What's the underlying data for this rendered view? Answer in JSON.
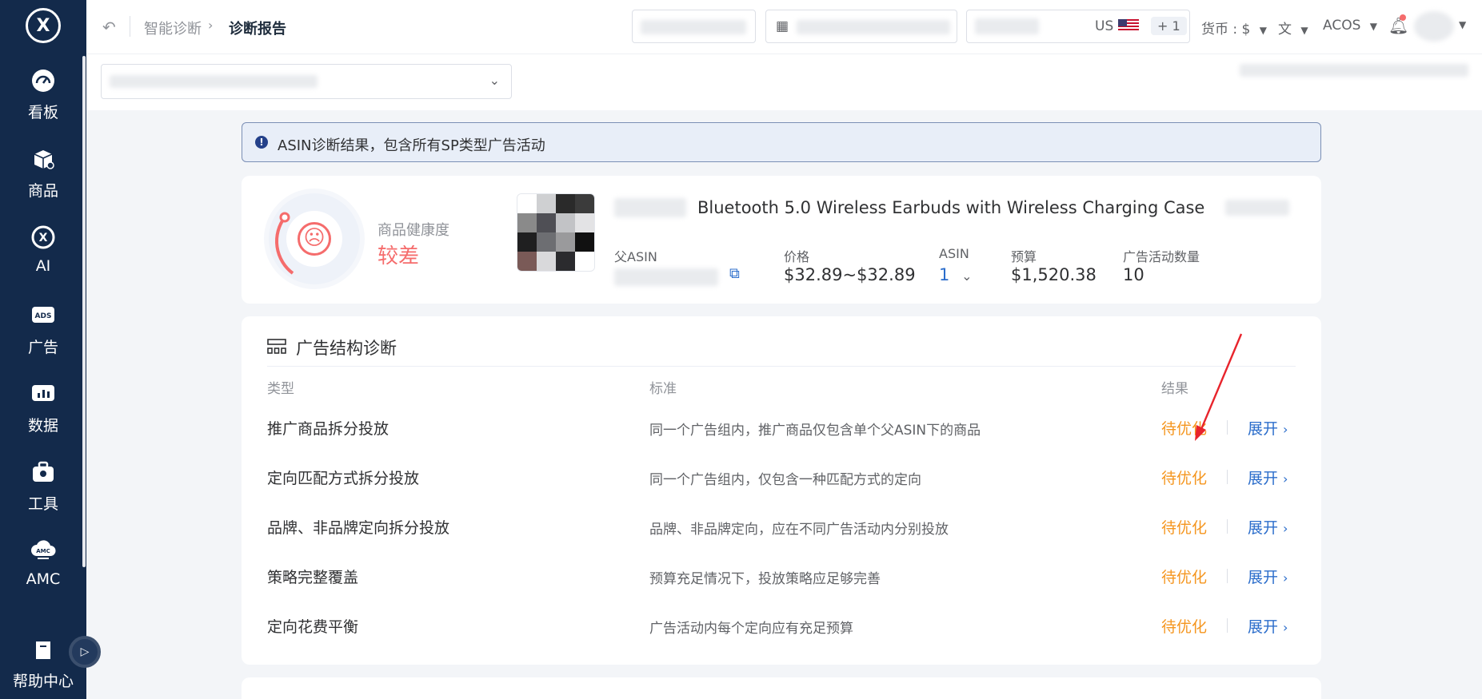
{
  "sidebar": {
    "logo": "X",
    "items": [
      {
        "label": "看板",
        "icon": "dashboard-icon"
      },
      {
        "label": "商品",
        "icon": "product-box-icon"
      },
      {
        "label": "AI",
        "icon": "ai-logo-icon"
      },
      {
        "label": "广告",
        "icon": "ads-icon"
      },
      {
        "label": "数据",
        "icon": "data-icon"
      },
      {
        "label": "工具",
        "icon": "toolbox-icon"
      },
      {
        "label": "AMC",
        "icon": "amc-cloud-icon"
      }
    ],
    "help_label": "帮助中心",
    "colors": {
      "background": "#132a4b"
    }
  },
  "topbar": {
    "breadcrumb": [
      "智能诊断",
      "诊断报告"
    ],
    "marketplace": "US",
    "extra_markets": "+ 1",
    "currency_label": "货币 : $",
    "metric": "ACOS",
    "icons": [
      "back-icon",
      "calendar-icon",
      "translate-icon",
      "bell-icon",
      "caret-down-icon"
    ]
  },
  "alert": {
    "text": "ASIN诊断结果，包含所有SP类型广告活动"
  },
  "product": {
    "health_label": "商品健康度",
    "health_value": "较差",
    "title": "Bluetooth 5.0 Wireless Earbuds with Wireless Charging Case",
    "parent_asin_label": "父ASIN",
    "price_label": "价格",
    "price_value": "$32.89~$32.89",
    "asin_label": "ASIN",
    "asin_value": "1",
    "budget_label": "预算",
    "budget_value": "$1,520.38",
    "campaign_count_label": "广告活动数量",
    "campaign_count_value": "10"
  },
  "diagnosis": {
    "title": "广告结构诊断",
    "columns": [
      "类型",
      "标准",
      "结果"
    ],
    "rows": [
      {
        "type": "推广商品拆分投放",
        "standard": "同一个广告组内，推广商品仅包含单个父ASIN下的商品",
        "result": "待优化",
        "action": "展开"
      },
      {
        "type": "定向匹配方式拆分投放",
        "standard": "同一个广告组内，仅包含一种匹配方式的定向",
        "result": "待优化",
        "action": "展开"
      },
      {
        "type": "品牌、非品牌定向拆分投放",
        "standard": "品牌、非品牌定向，应在不同广告活动内分别投放",
        "result": "待优化",
        "action": "展开"
      },
      {
        "type": "策略完整覆盖",
        "standard": "预算充足情况下，投放策略应足够完善",
        "result": "待优化",
        "action": "展开"
      },
      {
        "type": "定向花费平衡",
        "standard": "广告活动内每个定向应有充足预算",
        "result": "待优化",
        "action": "展开"
      }
    ],
    "colors": {
      "result": "#f5961f",
      "action": "#2b6dcb"
    }
  }
}
